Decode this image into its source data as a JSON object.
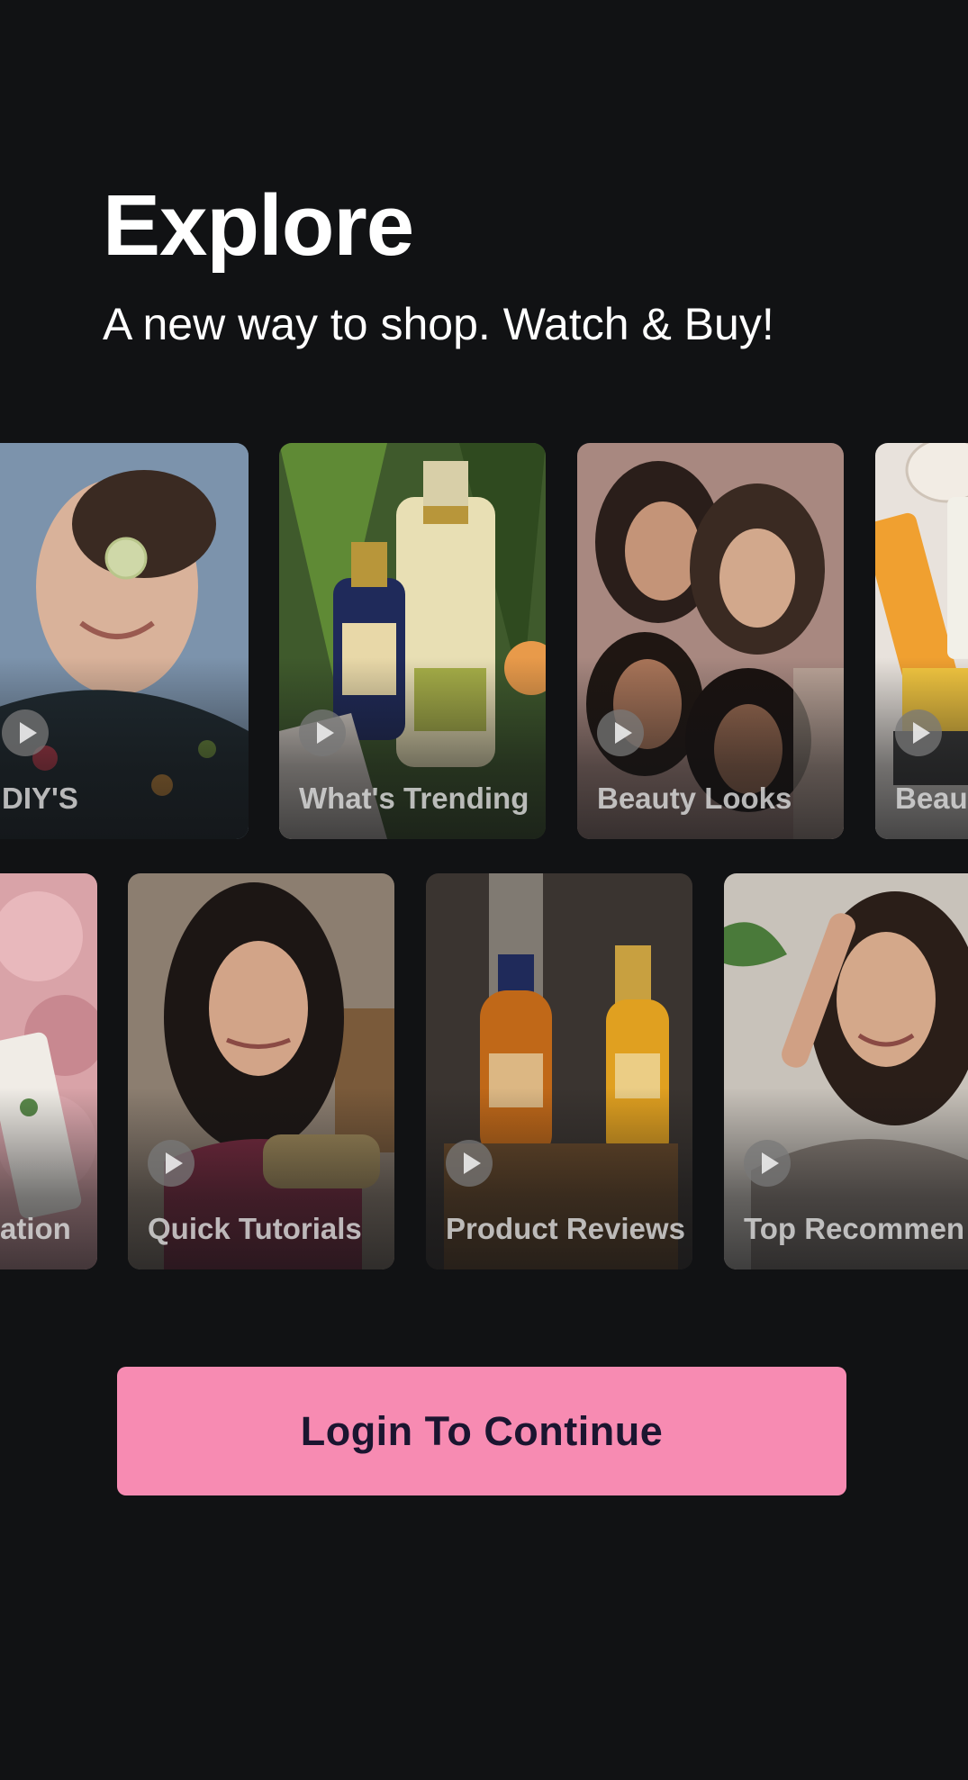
{
  "header": {
    "title": "Explore",
    "subtitle": "A new way to shop. Watch & Buy!"
  },
  "rows": [
    {
      "cards": [
        {
          "label": "DIY'S",
          "icon": "play-icon"
        },
        {
          "label": "What's Trending",
          "icon": "play-icon"
        },
        {
          "label": "Beauty Looks",
          "icon": "play-icon"
        },
        {
          "label": "Beau",
          "icon": "play-icon"
        }
      ]
    },
    {
      "cards": [
        {
          "label": "ation",
          "icon": "play-icon"
        },
        {
          "label": "Quick Tutorials",
          "icon": "play-icon"
        },
        {
          "label": "Product Reviews",
          "icon": "play-icon"
        },
        {
          "label": "Top Recommen",
          "icon": "play-icon"
        }
      ]
    }
  ],
  "login_button": {
    "label": "Login To Continue"
  },
  "colors": {
    "background": "#111214",
    "accent": "#f78bb2",
    "button_text": "#1b1530"
  }
}
